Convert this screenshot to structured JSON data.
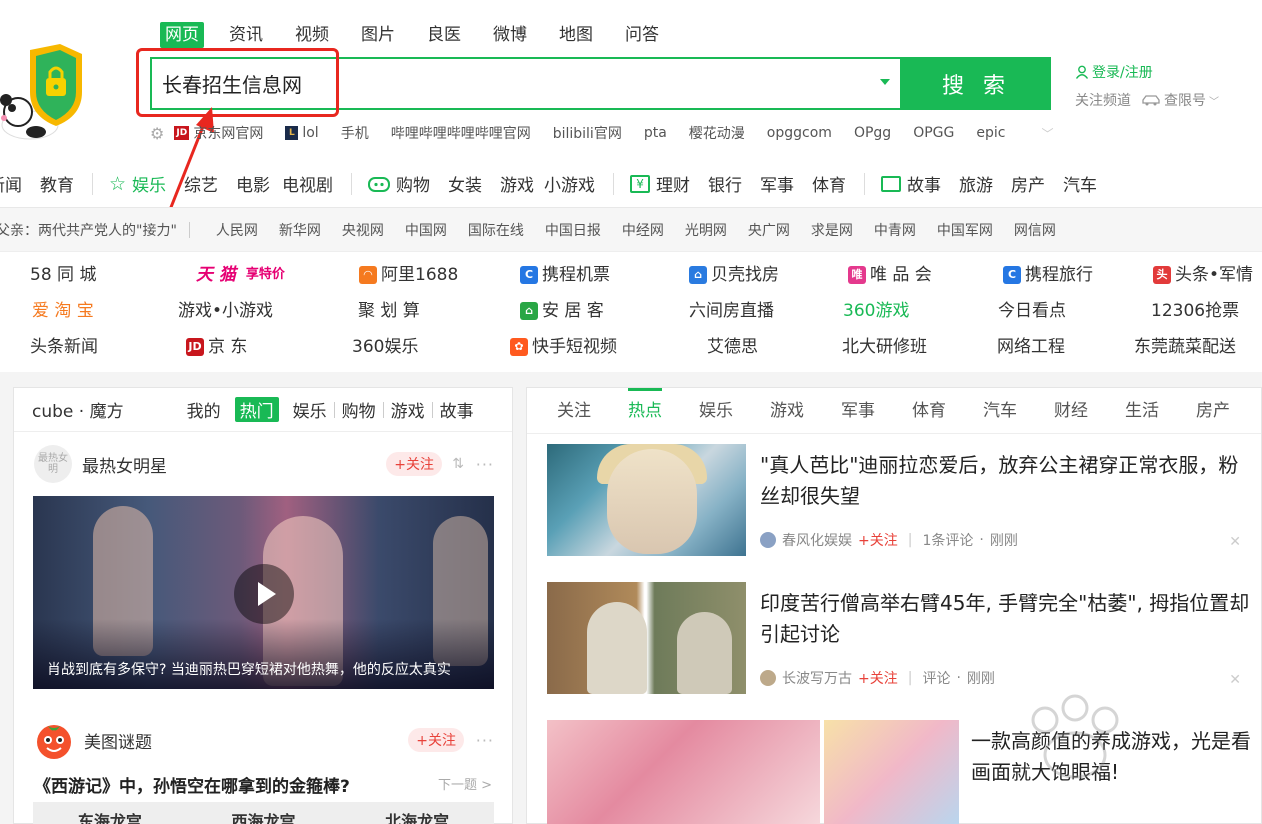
{
  "search": {
    "tabs": [
      "网页",
      "资讯",
      "视频",
      "图片",
      "良医",
      "微博",
      "地图",
      "问答"
    ],
    "query": "长春招生信息网",
    "button_label": "搜 索"
  },
  "user": {
    "login_label": "登录/注册",
    "follow_channel": "关注频道",
    "traffic_label": "查限号"
  },
  "hot_links": [
    "京东网官网",
    "lol",
    "手机",
    "哔哩哔哩哔哩哔哩官网",
    "bilibili官网",
    "pta",
    "樱花动漫",
    "opggcom",
    "OPgg",
    "OPGG",
    "epic"
  ],
  "categories": [
    "新闻",
    "教育",
    "娱乐",
    "综艺",
    "电影",
    "电视剧",
    "购物",
    "女装",
    "游戏",
    "小游戏",
    "理财",
    "银行",
    "军事",
    "体育",
    "故事",
    "旅游",
    "房产",
    "汽车"
  ],
  "news_bar": {
    "headline": "父亲：两代共产党人的\"接力\"",
    "sites": [
      "人民网",
      "新华网",
      "央视网",
      "中国网",
      "国际在线",
      "中国日报",
      "中经网",
      "光明网",
      "央广网",
      "求是网",
      "中青网",
      "中国军网",
      "网信网"
    ]
  },
  "sites": [
    "58 同 城",
    "天 猫",
    "阿里1688",
    "携程机票",
    "贝壳找房",
    "唯 品 会",
    "携程旅行",
    "头条•军情",
    "爱 淘 宝",
    "游戏•小游戏",
    "聚 划 算",
    "安 居 客",
    "六间房直播",
    "360游戏",
    "今日看点",
    "12306抢票",
    "头条新闻",
    "京 东",
    "360娱乐",
    "快手短视频",
    "艾德思",
    "北大研修班",
    "网络工程",
    "东莞蔬菜配送"
  ],
  "tmall_promo": "享特价",
  "cube": {
    "title": "cube · 魔方",
    "tabs": [
      "我的",
      "热门",
      "娱乐",
      "购物",
      "游戏",
      "故事"
    ],
    "card1": {
      "avatar_text": "最热女明",
      "name": "最热女明星",
      "follow": "+关注",
      "video_caption": "肖战到底有多保守? 当迪丽热巴穿短裙对他热舞，他的反应太真实"
    },
    "card2": {
      "name": "美图谜题",
      "follow": "+关注",
      "question": "《西游记》中，孙悟空在哪拿到的金箍棒?",
      "next": "下一题 >",
      "options": [
        "东海龙宫",
        "西海龙宫",
        "北海龙宫"
      ]
    }
  },
  "feed": {
    "tabs": [
      "关注",
      "热点",
      "娱乐",
      "游戏",
      "军事",
      "体育",
      "汽车",
      "财经",
      "生活",
      "房产"
    ],
    "items": [
      {
        "title": "\"真人芭比\"迪丽拉恋爱后，放弃公主裙穿正常衣服，粉丝却很失望",
        "source": "春风化娱娱",
        "follow": "+关注",
        "comments": "1条评论",
        "time": "刚刚"
      },
      {
        "title": "印度苦行僧高举右臂45年, 手臂完全\"枯萎\", 拇指位置却引起讨论",
        "source": "长波写万古",
        "follow": "+关注",
        "comments": "评论",
        "time": "刚刚"
      },
      {
        "title": "一款高颜值的养成游戏，光是看画面就大饱眼福!"
      }
    ]
  },
  "colors": {
    "accent": "#19b955",
    "highlight_frame": "#e8271f",
    "follow": "#e8423a",
    "taobao": "#f57a20",
    "tmall": "#e60073"
  }
}
